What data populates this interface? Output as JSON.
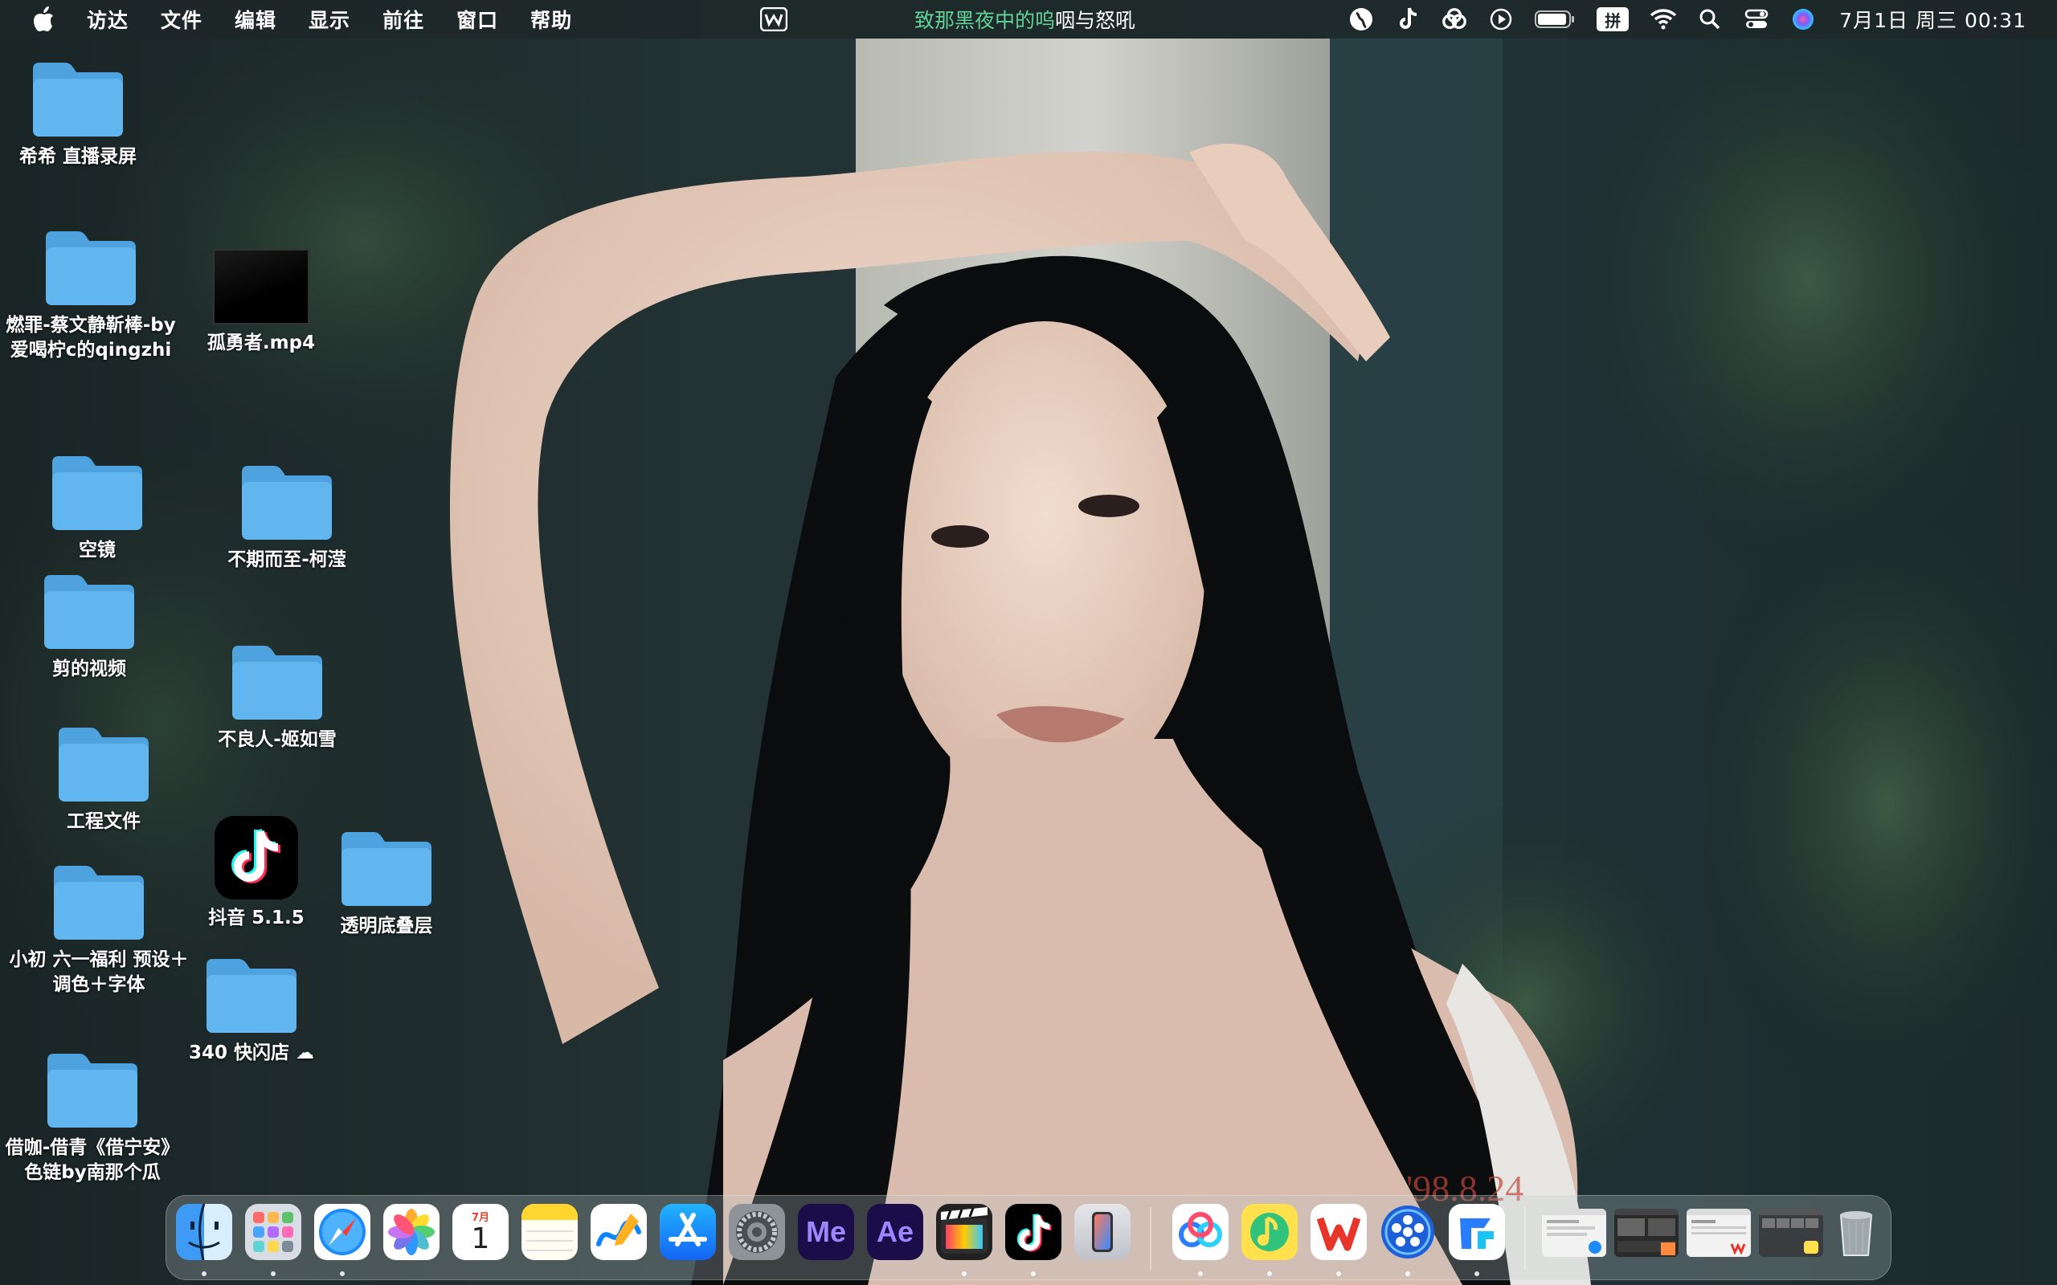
{
  "menubar": {
    "apple_icon": "apple-icon",
    "items": [
      "访达",
      "文件",
      "编辑",
      "显示",
      "前往",
      "窗口",
      "帮助"
    ],
    "now_playing_highlight": "致那黑夜中的呜",
    "now_playing_rest": "咽与怒吼",
    "input_method": "拼",
    "clock": "7月1日 周三  00:31",
    "status_icons": [
      "globe-icon",
      "tiktok-icon",
      "creative-cloud-icon",
      "play-icon",
      "battery-icon",
      "input-method-icon",
      "wifi-icon",
      "search-icon",
      "control-center-icon",
      "siri-icon"
    ]
  },
  "desktop": {
    "items": [
      {
        "name": "folder-xixi-live-recording",
        "label": "希希 直播录屏",
        "kind": "folder"
      },
      {
        "name": "folder-ranzui",
        "label": "燃罪-蔡文静靳棒-by\n爱喝柠c的qingzhi",
        "kind": "folder"
      },
      {
        "name": "file-guyongzhe-mp4",
        "label": "孤勇者.mp4",
        "kind": "video"
      },
      {
        "name": "folder-kongjing",
        "label": "空镜",
        "kind": "folder"
      },
      {
        "name": "folder-buqierzhi",
        "label": "不期而至-柯滢",
        "kind": "folder"
      },
      {
        "name": "folder-jian-de-shipin",
        "label": "剪的视频",
        "kind": "folder"
      },
      {
        "name": "folder-buliangren",
        "label": "不良人-姬如雪",
        "kind": "folder"
      },
      {
        "name": "folder-gongcheng-wenjian",
        "label": "工程文件",
        "kind": "folder"
      },
      {
        "name": "app-douyin",
        "label": "抖音 5.1.5",
        "kind": "app"
      },
      {
        "name": "folder-toumingdi",
        "label": "透明底叠层",
        "kind": "folder"
      },
      {
        "name": "folder-xiaochu-liuyi",
        "label": "小初 六一福利 预设＋\n调色＋字体",
        "kind": "folder"
      },
      {
        "name": "folder-340-kuaishandian",
        "label": "340 快闪店 ☁",
        "kind": "folder"
      },
      {
        "name": "folder-jieka",
        "label": "借咖-借青《借宁安》\n色链by南那个瓜",
        "kind": "folder"
      }
    ]
  },
  "dock": {
    "apps": [
      {
        "name": "finder",
        "icon": "finder-icon",
        "running": true
      },
      {
        "name": "launchpad",
        "icon": "launchpad-icon",
        "running": true
      },
      {
        "name": "safari",
        "icon": "safari-icon",
        "running": true
      },
      {
        "name": "photos",
        "icon": "photos-icon",
        "running": false
      },
      {
        "name": "calendar",
        "icon": "calendar-icon",
        "month": "7月",
        "day": "1",
        "running": false
      },
      {
        "name": "notes",
        "icon": "notes-icon",
        "running": false
      },
      {
        "name": "freeform",
        "icon": "freeform-icon",
        "running": false
      },
      {
        "name": "app-store",
        "icon": "app-store-icon",
        "running": false
      },
      {
        "name": "system-settings",
        "icon": "settings-icon",
        "running": false
      },
      {
        "name": "media-encoder",
        "icon": "media-encoder-icon",
        "text": "Me",
        "running": false
      },
      {
        "name": "after-effects",
        "icon": "after-effects-icon",
        "text": "Ae",
        "running": false
      },
      {
        "name": "final-cut-pro",
        "icon": "final-cut-icon",
        "running": true
      },
      {
        "name": "douyin",
        "icon": "tiktok-icon",
        "running": true
      },
      {
        "name": "iphone-mirroring",
        "icon": "iphone-mirroring-icon",
        "running": false
      },
      {
        "name": "baidu-netdisk",
        "icon": "baidu-netdisk-icon",
        "running": true
      },
      {
        "name": "qq-music",
        "icon": "qq-music-icon",
        "running": true
      },
      {
        "name": "wps-office",
        "icon": "wps-icon",
        "running": true
      },
      {
        "name": "kuaishou-video",
        "icon": "video-editor-icon",
        "running": true
      },
      {
        "name": "feishu-transfer",
        "icon": "transfer-icon",
        "running": true
      }
    ],
    "windows": [
      "minimized-window-1",
      "minimized-window-2",
      "minimized-window-3",
      "minimized-window-4"
    ],
    "trash": "trash-icon"
  },
  "colors": {
    "folder_fill": "#62b6f0",
    "folder_tab": "#4ea3de",
    "now_playing": "#63d29a",
    "menubar_bg": "#1e2628"
  }
}
